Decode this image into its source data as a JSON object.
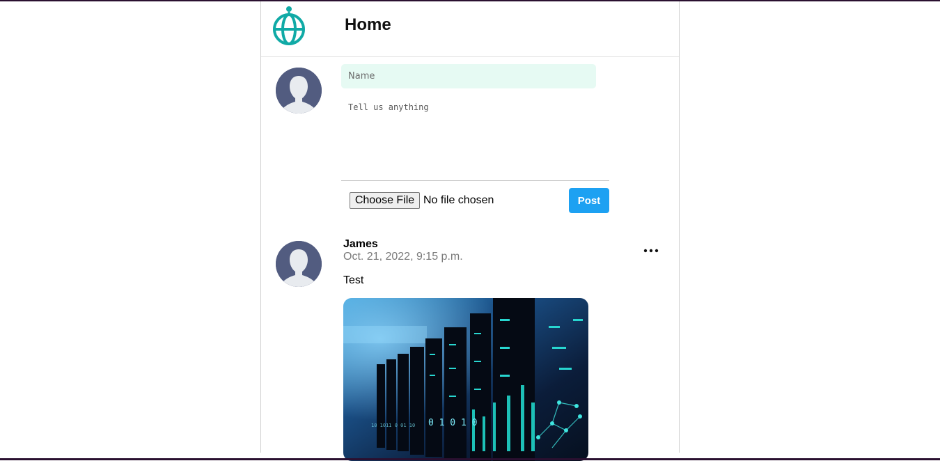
{
  "header": {
    "title": "Home",
    "logo_icon": "globe-icon",
    "logo_color": "#10aaa6"
  },
  "composer": {
    "avatar_icon": "default-user-avatar",
    "name_placeholder": "Name",
    "body_placeholder": "Tell us anything",
    "file_button_label": "Choose File",
    "file_status": "No file chosen",
    "post_button_label": "Post",
    "post_button_color": "#1da1f2",
    "name_field_bg": "#e6faf3"
  },
  "post": {
    "author": "James",
    "date": "Oct. 21, 2022, 9:15 p.m.",
    "text": "Test",
    "more_icon": "more-horizontal-icon",
    "image_description_icon": "server-room-image"
  }
}
